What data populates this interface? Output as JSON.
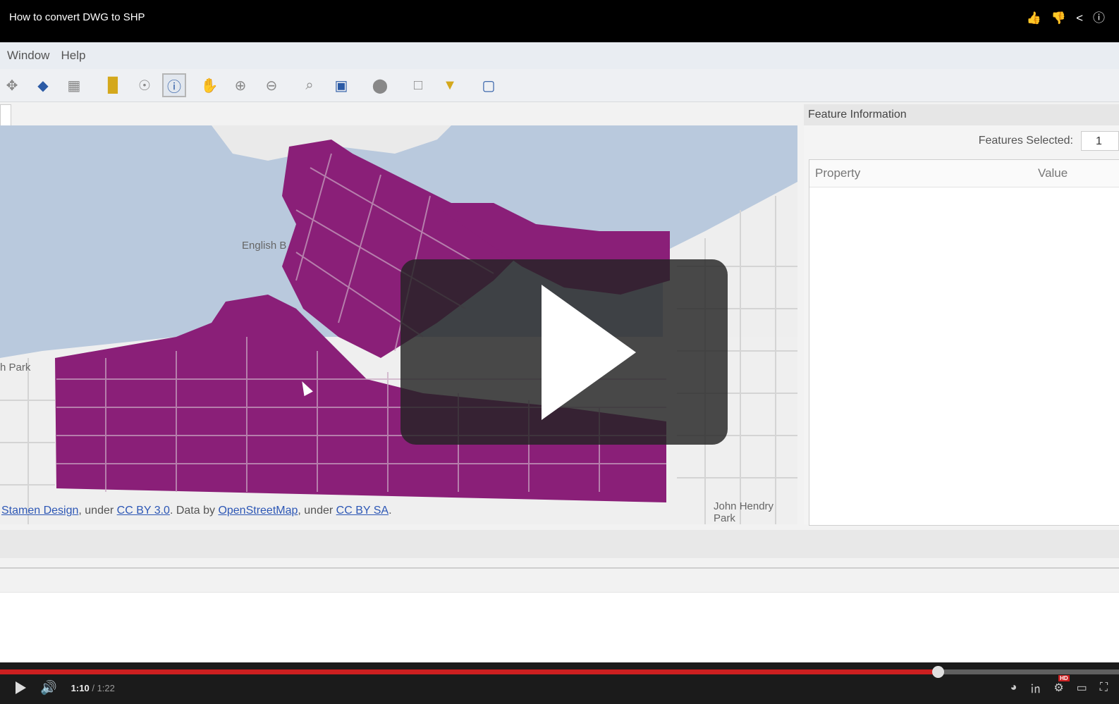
{
  "player": {
    "title": "How to convert DWG to SHP",
    "icons": [
      "thumbs-up-icon",
      "thumbs-down-icon",
      "share-icon",
      "info-icon"
    ],
    "progress_fraction": 0.838,
    "time": {
      "current": "1:10",
      "separator": "/",
      "total": "1:22"
    },
    "hd_badge": "HD",
    "colors": {
      "progress": "#cc1f20",
      "overlay": "#232323"
    }
  },
  "app": {
    "menu": [
      "Window",
      "Help"
    ],
    "toolbar": [
      "select-tool-icon",
      "edit-tool-icon",
      "table-icon",
      "layers-icon",
      "identify-disabled-icon",
      "info-tool-icon",
      "pan-icon",
      "zoom-in-icon",
      "zoom-out-icon",
      "zoom-selection-icon",
      "zoom-extent-icon",
      "record-icon",
      "scale-icon",
      "filter-icon",
      "3d-icon"
    ],
    "active_tool": "info-tool-icon",
    "map": {
      "labels": [
        "English B",
        "h Park",
        "John Hendry Park"
      ],
      "attribution": {
        "part1": "Stamen Design",
        "part2": ", under ",
        "part3": "CC BY 3.0",
        "part4": ". Data by ",
        "part5": "OpenStreetMap",
        "part6": ", under ",
        "part7": "CC BY SA",
        "part8": "."
      },
      "colors": {
        "water": "#b9c9dd",
        "land": "#efefef",
        "parcels": "#8a1f78"
      }
    },
    "panel": {
      "title": "Feature Information",
      "features_label": "Features Selected:",
      "features_value": "1",
      "columns": [
        "Property",
        "Value"
      ]
    }
  }
}
